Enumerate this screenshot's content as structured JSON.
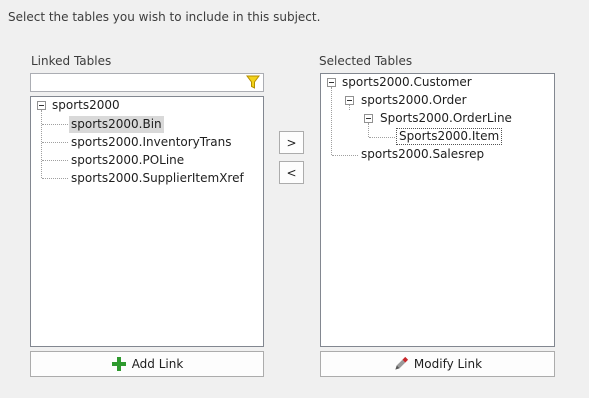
{
  "instruction": "Select the tables you wish to include in this subject.",
  "linked": {
    "label": "Linked Tables",
    "filter_value": "",
    "root": "sports2000",
    "children": [
      "sports2000.Bin",
      "sports2000.InventoryTrans",
      "sports2000.POLine",
      "sports2000.SupplierItemXref"
    ],
    "selected_item": "sports2000.Bin"
  },
  "selected": {
    "label": "Selected Tables",
    "root": "sports2000.Customer",
    "order": "sports2000.Order",
    "orderline": "Sports2000.OrderLine",
    "item": "Sports2000.Item",
    "salesrep": "sports2000.Salesrep",
    "focused_item": "Sports2000.Item"
  },
  "buttons": {
    "add": ">",
    "remove": "<",
    "add_link": "Add Link",
    "modify_link": "Modify Link"
  },
  "icons": {
    "filter": "funnel-icon",
    "add_link": "green-plus-icon",
    "modify_link": "pencil-eraser-icon"
  },
  "colors": {
    "filter_icon": "#f2d21b",
    "add_icon": "#2e9a2e",
    "modify_icon": "#c8272b"
  }
}
